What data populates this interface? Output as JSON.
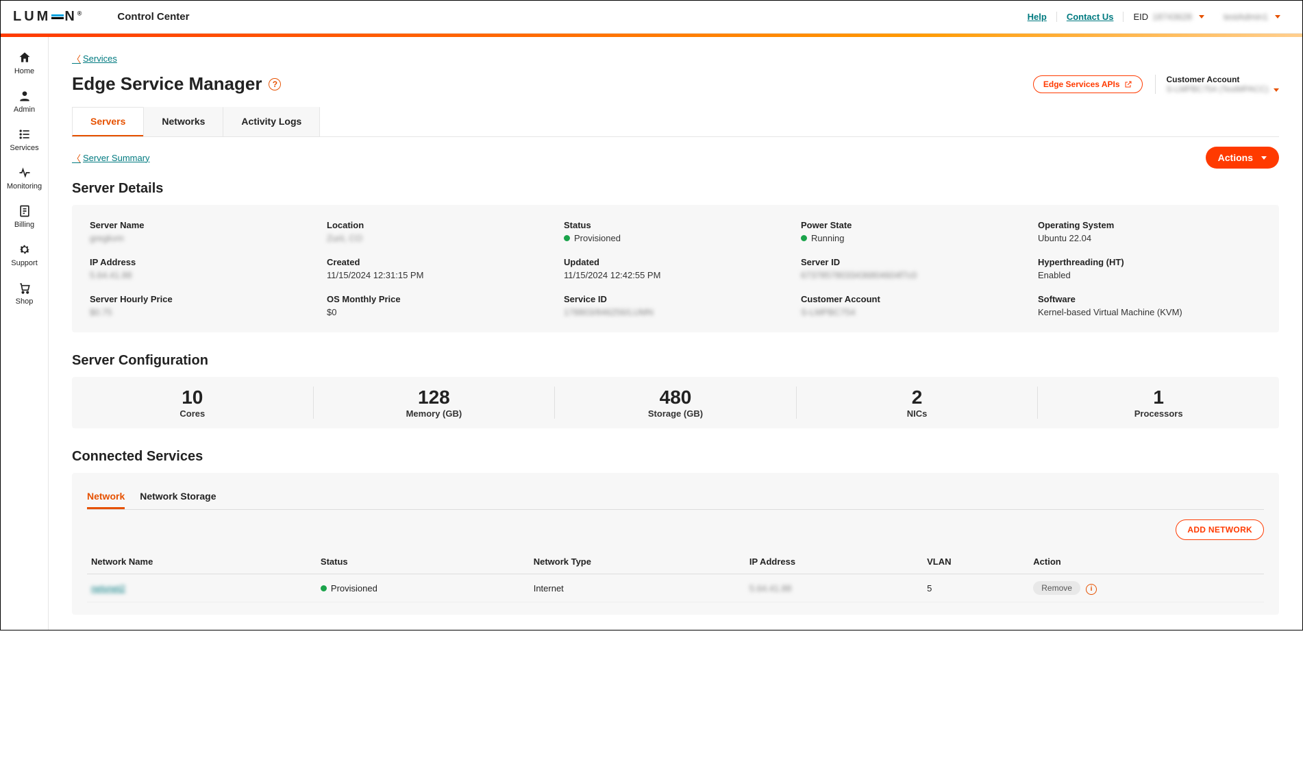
{
  "header": {
    "logo_text": "LUM  N",
    "app": "Control Center",
    "help": "Help",
    "contact": "Contact Us",
    "eid_label": "EID",
    "eid_value": "18743628",
    "user": "testAdmin1"
  },
  "sidebar": {
    "items": [
      {
        "label": "Home",
        "icon": "home"
      },
      {
        "label": "Admin",
        "icon": "user"
      },
      {
        "label": "Services",
        "icon": "list"
      },
      {
        "label": "Monitoring",
        "icon": "pulse"
      },
      {
        "label": "Billing",
        "icon": "bill"
      },
      {
        "label": "Support",
        "icon": "gear"
      },
      {
        "label": "Shop",
        "icon": "cart"
      }
    ]
  },
  "breadcrumb": {
    "parent": "Services"
  },
  "page": {
    "title": "Edge Service Manager",
    "api_button": "Edge Services APIs",
    "customer_account_label": "Customer Account",
    "customer_account_value": "S-LMPBC754 (TestMPACC)"
  },
  "tabs": [
    {
      "label": "Servers",
      "active": true
    },
    {
      "label": "Networks",
      "active": false
    },
    {
      "label": "Activity Logs",
      "active": false
    }
  ],
  "sub_breadcrumb": "Server Summary",
  "actions_button": "Actions",
  "sections": {
    "details_title": "Server Details",
    "config_title": "Server Configuration",
    "connected_title": "Connected Services"
  },
  "details": {
    "fields": [
      {
        "label": "Server Name",
        "value": "gregkvm",
        "blur": true
      },
      {
        "label": "Location",
        "value": "Zurii, CO",
        "blur": true
      },
      {
        "label": "Status",
        "value": "Provisioned",
        "dot": true
      },
      {
        "label": "Power State",
        "value": "Running",
        "dot": true
      },
      {
        "label": "Operating System",
        "value": "Ubuntu 22.04"
      },
      {
        "label": "IP Address",
        "value": "5.64.41.88",
        "blur": true
      },
      {
        "label": "Created",
        "value": "11/15/2024 12:31:15 PM"
      },
      {
        "label": "Updated",
        "value": "11/15/2024 12:42:55 PM"
      },
      {
        "label": "Server ID",
        "value": "67378578033436804604f7c0",
        "blur": true
      },
      {
        "label": "Hyperthreading (HT)",
        "value": "Enabled"
      },
      {
        "label": "Server Hourly Price",
        "value": "$0.75",
        "blur": true
      },
      {
        "label": "OS Monthly Price",
        "value": "$0"
      },
      {
        "label": "Service ID",
        "value": "178803/846256/LUMN",
        "blur": true
      },
      {
        "label": "Customer Account",
        "value": "S-LMPBC754",
        "blur": true
      },
      {
        "label": "Software",
        "value": "Kernel-based Virtual Machine (KVM)"
      }
    ]
  },
  "config": {
    "stats": [
      {
        "num": "10",
        "label": "Cores"
      },
      {
        "num": "128",
        "label": "Memory (GB)"
      },
      {
        "num": "480",
        "label": "Storage (GB)"
      },
      {
        "num": "2",
        "label": "NICs"
      },
      {
        "num": "1",
        "label": "Processors"
      }
    ]
  },
  "connected": {
    "subtabs": [
      {
        "label": "Network",
        "active": true
      },
      {
        "label": "Network Storage",
        "active": false
      }
    ],
    "add_button": "ADD NETWORK",
    "columns": [
      "Network Name",
      "Status",
      "Network Type",
      "IP Address",
      "VLAN",
      "Action"
    ],
    "rows": [
      {
        "name": "netvnet2",
        "status": "Provisioned",
        "type": "Internet",
        "ip": "5.64.41.88",
        "vlan": "5",
        "action": "Remove"
      }
    ]
  }
}
